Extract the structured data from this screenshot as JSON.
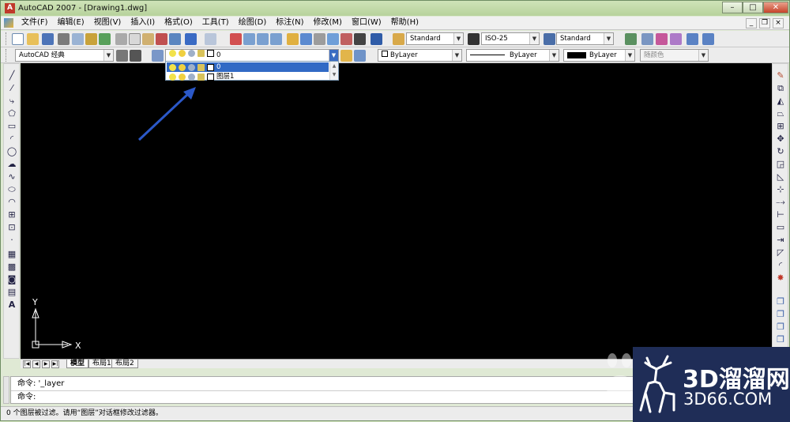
{
  "window": {
    "title": "AutoCAD 2007 - [Drawing1.dwg]",
    "app_icon": "A"
  },
  "window_controls": {
    "minimize": "–",
    "maximize": "□",
    "close": "✕"
  },
  "mdi_controls": {
    "minimize": "_",
    "restore": "❐",
    "close": "×"
  },
  "menu": [
    {
      "label": "文件(F)"
    },
    {
      "label": "编辑(E)"
    },
    {
      "label": "视图(V)"
    },
    {
      "label": "插入(I)"
    },
    {
      "label": "格式(O)"
    },
    {
      "label": "工具(T)"
    },
    {
      "label": "绘图(D)"
    },
    {
      "label": "标注(N)"
    },
    {
      "label": "修改(M)"
    },
    {
      "label": "窗口(W)"
    },
    {
      "label": "帮助(H)"
    }
  ],
  "styles_toolbar": {
    "text_style": "Standard",
    "dim_style": "ISO-25",
    "table_style": "Standard"
  },
  "workspace": {
    "value": "AutoCAD 经典"
  },
  "layers": {
    "current": "0",
    "dropdown_open": true,
    "items": [
      {
        "name": "0",
        "selected": true
      },
      {
        "name": "图层1",
        "selected": false
      }
    ]
  },
  "properties": {
    "color": "ByLayer",
    "linetype": "ByLayer",
    "lineweight": "ByLayer",
    "plotstyle": "随颜色"
  },
  "ucs": {
    "x_label": "X",
    "y_label": "Y"
  },
  "layout_tabs": [
    "模型",
    "布局1",
    "布局2"
  ],
  "command_lines": [
    "命令: '_layer",
    "命令:"
  ],
  "status_text": "0 个图层被过滤。请用“图层”对话框修改过滤器。",
  "watermark": {
    "big": "3D溜溜网",
    "small": "3D66.COM"
  },
  "colors": {
    "drawing_bg": "#000000",
    "arrow": "#2b58c8",
    "selection": "#316ac5"
  }
}
